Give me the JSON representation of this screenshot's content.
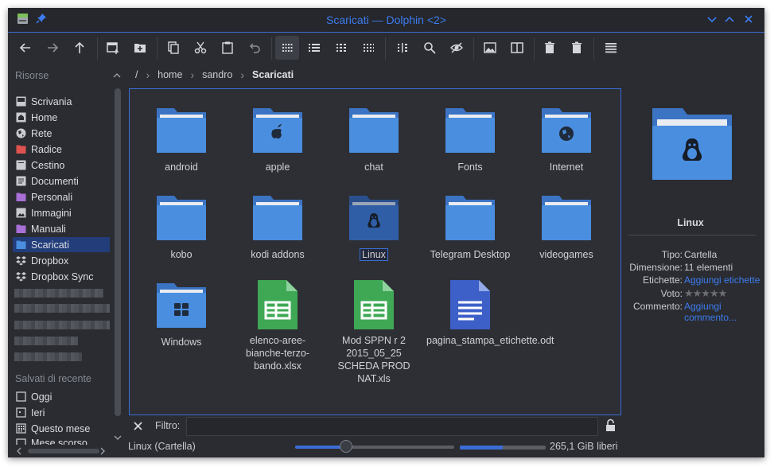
{
  "window": {
    "title": "Scaricati — Dolphin <2>"
  },
  "toolbar": {
    "buttons": [
      "back-button",
      "forward-button",
      "up-button",
      "new-tab-button",
      "new-folder-button",
      "copy-button",
      "cut-button",
      "paste-button",
      "undo-button",
      "icons-view-button",
      "details-view-button",
      "compact-view-button",
      "grid-view-button",
      "columns-button",
      "search-button",
      "hidden-files-button",
      "preview-button",
      "split-button",
      "trash-button",
      "delete-button",
      "menu-button"
    ]
  },
  "sidebar": {
    "places_heading": "Risorse",
    "places": [
      {
        "label": "Scrivania",
        "icon": "desktop-icon"
      },
      {
        "label": "Home",
        "icon": "home-icon"
      },
      {
        "label": "Rete",
        "icon": "network-icon"
      },
      {
        "label": "Radice",
        "icon": "root-folder-icon"
      },
      {
        "label": "Cestino",
        "icon": "trash-icon"
      },
      {
        "label": "Documenti",
        "icon": "documents-icon"
      },
      {
        "label": "Personali",
        "icon": "personal-folder-icon"
      },
      {
        "label": "Immagini",
        "icon": "images-icon"
      },
      {
        "label": "Manuali",
        "icon": "manuals-folder-icon"
      },
      {
        "label": "Scaricati",
        "icon": "downloads-icon"
      },
      {
        "label": "Dropbox",
        "icon": "dropbox-icon"
      },
      {
        "label": "Dropbox Sync",
        "icon": "dropbox-sync-icon"
      }
    ],
    "recent_heading": "Salvati di recente",
    "recent": [
      {
        "label": "Oggi"
      },
      {
        "label": "Ieri"
      },
      {
        "label": "Questo mese"
      },
      {
        "label": "Mese scorso"
      }
    ]
  },
  "breadcrumb": {
    "root": "/",
    "parts": [
      "home",
      "sandro"
    ],
    "current": "Scaricati"
  },
  "files": [
    {
      "label": "android",
      "type": "folder"
    },
    {
      "label": "apple",
      "type": "folder-apple"
    },
    {
      "label": "chat",
      "type": "folder"
    },
    {
      "label": "Fonts",
      "type": "folder"
    },
    {
      "label": "Internet",
      "type": "folder-internet"
    },
    {
      "label": "kobo",
      "type": "folder"
    },
    {
      "label": "kodi addons",
      "type": "folder"
    },
    {
      "label": "Linux",
      "type": "folder-linux"
    },
    {
      "label": "Telegram Desktop",
      "type": "folder"
    },
    {
      "label": "videogames",
      "type": "folder"
    },
    {
      "label": "Windows",
      "type": "folder-windows"
    },
    {
      "label": "elenco-aree-bianche-terzo-bando.xlsx",
      "type": "spreadsheet"
    },
    {
      "label": "Mod SPPN r 2 2015_05_25 SCHEDA PROD NAT.xls",
      "type": "spreadsheet"
    },
    {
      "label": "pagina_stampa_etichette.odt",
      "type": "document"
    }
  ],
  "info": {
    "name": "Linux",
    "tipo_label": "Tipo:",
    "tipo": "Cartella",
    "dim_label": "Dimensione:",
    "dim": "11 elementi",
    "etichette_label": "Etichette:",
    "etichette": "Aggiungi etichette",
    "voto_label": "Voto:",
    "rating": 0,
    "commento_label": "Commento:",
    "commento_1": "Aggiungi",
    "commento_2": "commento..."
  },
  "filter": {
    "label": "Filtro:",
    "value": ""
  },
  "status": {
    "text": "Linux (Cartella)",
    "free": "265,1 GiB liberi",
    "zoom": 0.32,
    "disk_used": 0.5
  },
  "colors": {
    "accent": "#3b6dd6",
    "folder": "#4a8ee0",
    "sheet": "#3fa855",
    "doc": "#3d5fc8"
  }
}
